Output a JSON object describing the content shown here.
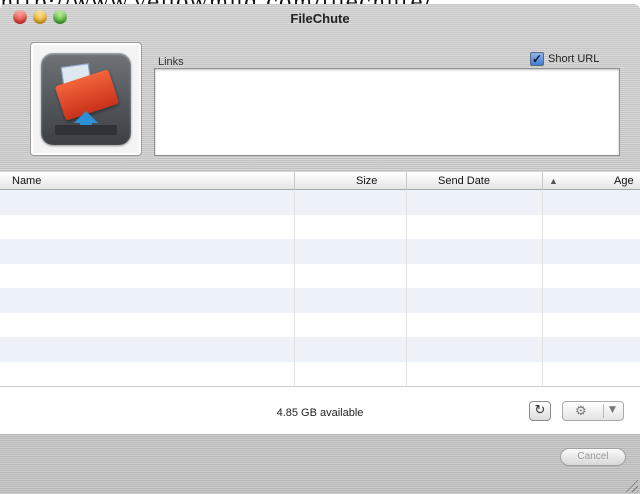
{
  "page": {
    "caption": "http://www.yellowmug.com/filechute/"
  },
  "window": {
    "title": "FileChute",
    "app_icon": "filechute-app-icon"
  },
  "links": {
    "label": "Links",
    "value": "",
    "short_url_label": "Short URL",
    "short_url_checked": true
  },
  "table": {
    "columns": [
      "Name",
      "Size",
      "Send Date",
      "Age"
    ],
    "sort_indicator": "▲",
    "rows": []
  },
  "status": {
    "available": "4.85 GB available",
    "refresh_icon": "refresh-icon",
    "action_icon": "gear-icon"
  },
  "footer": {
    "cancel_label": "Cancel"
  },
  "colors": {
    "stripe": "#edf2f9",
    "close": "#d9342b",
    "minimize": "#e0a11c",
    "zoom": "#3fa52a",
    "checkbox": "#3f7dd0"
  }
}
